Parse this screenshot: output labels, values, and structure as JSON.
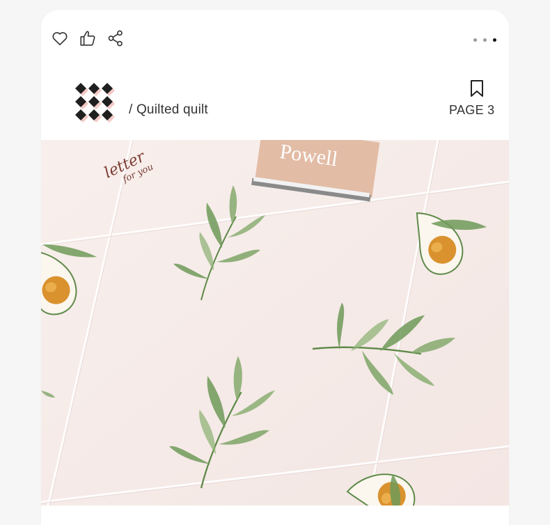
{
  "toolbar": {
    "icons": [
      "heart-icon",
      "thumbs-up-icon",
      "share-icon"
    ],
    "pagination_dots": 3,
    "active_dot": 3
  },
  "header": {
    "subtitle": "/ Quilted quilt",
    "page_label": "PAGE 3",
    "bookmark_icon": "bookmark-icon"
  },
  "photo": {
    "book_text": "Powell",
    "script_text_1": "letter",
    "script_text_2": "for you"
  },
  "colors": {
    "background": "#f6f6f6",
    "card": "#ffffff",
    "quilt": "#f6ece9",
    "leaf": "#6f9a58",
    "avocado_pit": "#d9922e",
    "book": "#ecc9b4"
  }
}
